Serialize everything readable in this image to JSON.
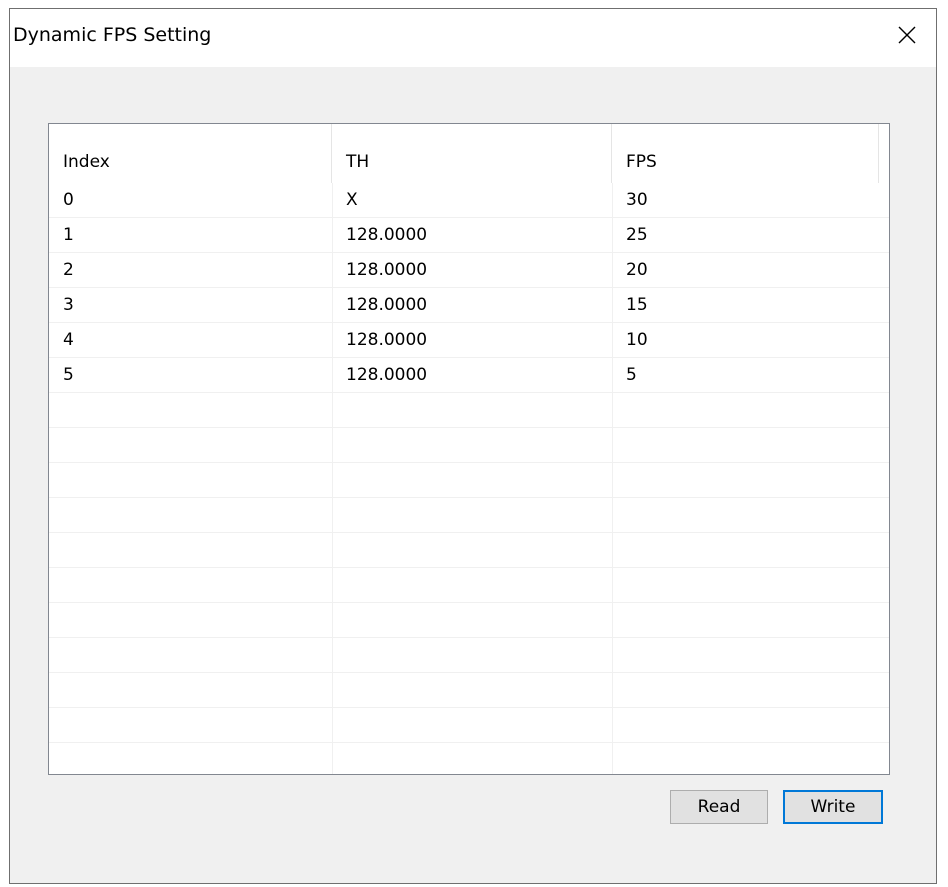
{
  "window": {
    "title": "Dynamic FPS Setting",
    "close_icon": "close-icon"
  },
  "table": {
    "columns": [
      "Index",
      "TH",
      "FPS"
    ],
    "rows": [
      [
        "0",
        "X",
        "30"
      ],
      [
        "1",
        "128.0000",
        "25"
      ],
      [
        "2",
        "128.0000",
        "20"
      ],
      [
        "3",
        "128.0000",
        "15"
      ],
      [
        "4",
        "128.0000",
        "10"
      ],
      [
        "5",
        "128.0000",
        "5"
      ]
    ],
    "empty_rows": 11
  },
  "buttons": {
    "read_label": "Read",
    "write_label": "Write"
  },
  "colors": {
    "accent": "#0078d7",
    "dialog_bg": "#f0f0f0"
  }
}
